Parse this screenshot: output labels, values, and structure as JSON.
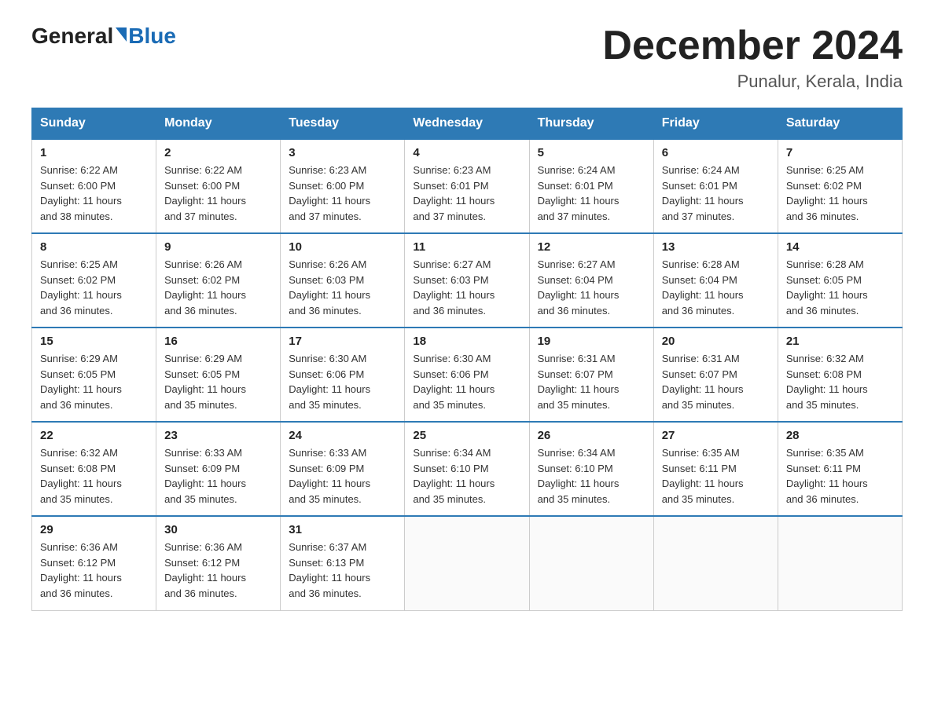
{
  "header": {
    "logo_general": "General",
    "logo_blue": "Blue",
    "month_title": "December 2024",
    "location": "Punalur, Kerala, India"
  },
  "days_of_week": [
    "Sunday",
    "Monday",
    "Tuesday",
    "Wednesday",
    "Thursday",
    "Friday",
    "Saturday"
  ],
  "weeks": [
    [
      {
        "day": "1",
        "sunrise": "6:22 AM",
        "sunset": "6:00 PM",
        "daylight": "11 hours and 38 minutes."
      },
      {
        "day": "2",
        "sunrise": "6:22 AM",
        "sunset": "6:00 PM",
        "daylight": "11 hours and 37 minutes."
      },
      {
        "day": "3",
        "sunrise": "6:23 AM",
        "sunset": "6:00 PM",
        "daylight": "11 hours and 37 minutes."
      },
      {
        "day": "4",
        "sunrise": "6:23 AM",
        "sunset": "6:01 PM",
        "daylight": "11 hours and 37 minutes."
      },
      {
        "day": "5",
        "sunrise": "6:24 AM",
        "sunset": "6:01 PM",
        "daylight": "11 hours and 37 minutes."
      },
      {
        "day": "6",
        "sunrise": "6:24 AM",
        "sunset": "6:01 PM",
        "daylight": "11 hours and 37 minutes."
      },
      {
        "day": "7",
        "sunrise": "6:25 AM",
        "sunset": "6:02 PM",
        "daylight": "11 hours and 36 minutes."
      }
    ],
    [
      {
        "day": "8",
        "sunrise": "6:25 AM",
        "sunset": "6:02 PM",
        "daylight": "11 hours and 36 minutes."
      },
      {
        "day": "9",
        "sunrise": "6:26 AM",
        "sunset": "6:02 PM",
        "daylight": "11 hours and 36 minutes."
      },
      {
        "day": "10",
        "sunrise": "6:26 AM",
        "sunset": "6:03 PM",
        "daylight": "11 hours and 36 minutes."
      },
      {
        "day": "11",
        "sunrise": "6:27 AM",
        "sunset": "6:03 PM",
        "daylight": "11 hours and 36 minutes."
      },
      {
        "day": "12",
        "sunrise": "6:27 AM",
        "sunset": "6:04 PM",
        "daylight": "11 hours and 36 minutes."
      },
      {
        "day": "13",
        "sunrise": "6:28 AM",
        "sunset": "6:04 PM",
        "daylight": "11 hours and 36 minutes."
      },
      {
        "day": "14",
        "sunrise": "6:28 AM",
        "sunset": "6:05 PM",
        "daylight": "11 hours and 36 minutes."
      }
    ],
    [
      {
        "day": "15",
        "sunrise": "6:29 AM",
        "sunset": "6:05 PM",
        "daylight": "11 hours and 36 minutes."
      },
      {
        "day": "16",
        "sunrise": "6:29 AM",
        "sunset": "6:05 PM",
        "daylight": "11 hours and 35 minutes."
      },
      {
        "day": "17",
        "sunrise": "6:30 AM",
        "sunset": "6:06 PM",
        "daylight": "11 hours and 35 minutes."
      },
      {
        "day": "18",
        "sunrise": "6:30 AM",
        "sunset": "6:06 PM",
        "daylight": "11 hours and 35 minutes."
      },
      {
        "day": "19",
        "sunrise": "6:31 AM",
        "sunset": "6:07 PM",
        "daylight": "11 hours and 35 minutes."
      },
      {
        "day": "20",
        "sunrise": "6:31 AM",
        "sunset": "6:07 PM",
        "daylight": "11 hours and 35 minutes."
      },
      {
        "day": "21",
        "sunrise": "6:32 AM",
        "sunset": "6:08 PM",
        "daylight": "11 hours and 35 minutes."
      }
    ],
    [
      {
        "day": "22",
        "sunrise": "6:32 AM",
        "sunset": "6:08 PM",
        "daylight": "11 hours and 35 minutes."
      },
      {
        "day": "23",
        "sunrise": "6:33 AM",
        "sunset": "6:09 PM",
        "daylight": "11 hours and 35 minutes."
      },
      {
        "day": "24",
        "sunrise": "6:33 AM",
        "sunset": "6:09 PM",
        "daylight": "11 hours and 35 minutes."
      },
      {
        "day": "25",
        "sunrise": "6:34 AM",
        "sunset": "6:10 PM",
        "daylight": "11 hours and 35 minutes."
      },
      {
        "day": "26",
        "sunrise": "6:34 AM",
        "sunset": "6:10 PM",
        "daylight": "11 hours and 35 minutes."
      },
      {
        "day": "27",
        "sunrise": "6:35 AM",
        "sunset": "6:11 PM",
        "daylight": "11 hours and 35 minutes."
      },
      {
        "day": "28",
        "sunrise": "6:35 AM",
        "sunset": "6:11 PM",
        "daylight": "11 hours and 36 minutes."
      }
    ],
    [
      {
        "day": "29",
        "sunrise": "6:36 AM",
        "sunset": "6:12 PM",
        "daylight": "11 hours and 36 minutes."
      },
      {
        "day": "30",
        "sunrise": "6:36 AM",
        "sunset": "6:12 PM",
        "daylight": "11 hours and 36 minutes."
      },
      {
        "day": "31",
        "sunrise": "6:37 AM",
        "sunset": "6:13 PM",
        "daylight": "11 hours and 36 minutes."
      },
      null,
      null,
      null,
      null
    ]
  ],
  "labels": {
    "sunrise": "Sunrise:",
    "sunset": "Sunset:",
    "daylight": "Daylight:"
  }
}
